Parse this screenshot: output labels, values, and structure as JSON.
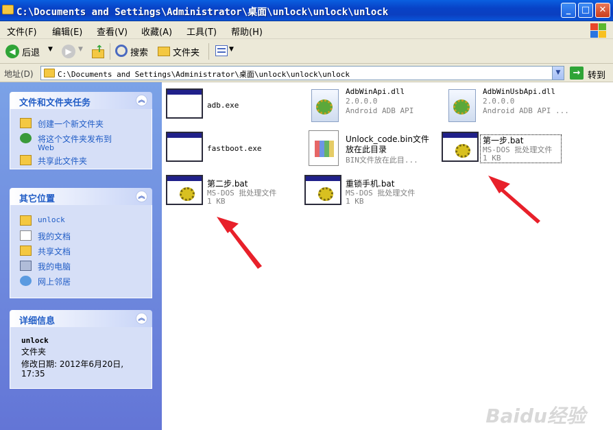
{
  "window": {
    "title": "C:\\Documents and Settings\\Administrator\\桌面\\unlock\\unlock\\unlock",
    "min": "_",
    "max": "□",
    "close": "✕"
  },
  "menu": [
    "文件(F)",
    "编辑(E)",
    "查看(V)",
    "收藏(A)",
    "工具(T)",
    "帮助(H)"
  ],
  "toolbar": {
    "back": "后退",
    "search": "搜索",
    "folders": "文件夹"
  },
  "address": {
    "label": "地址(D)",
    "path": "C:\\Documents and Settings\\Administrator\\桌面\\unlock\\unlock\\unlock",
    "go": "转到"
  },
  "tasks": {
    "title": "文件和文件夹任务",
    "items": [
      "创建一个新文件夹",
      "将这个文件夹发布到",
      "Web",
      "共享此文件夹"
    ]
  },
  "places": {
    "title": "其它位置",
    "items": [
      "unlock",
      "我的文档",
      "共享文档",
      "我的电脑",
      "网上邻居"
    ]
  },
  "details": {
    "title": "详细信息",
    "name": "unlock",
    "type": "文件夹",
    "modified": "修改日期: 2012年6月20日,",
    "time": "17:35"
  },
  "files": [
    {
      "name": "adb.exe",
      "line2": "",
      "line3": ""
    },
    {
      "name": "AdbWinApi.dll",
      "line2": "2.0.0.0",
      "line3": "Android ADB API"
    },
    {
      "name": "AdbWinUsbApi.dll",
      "line2": "2.0.0.0",
      "line3": "Android ADB API ..."
    },
    {
      "name": "fastboot.exe",
      "line2": "",
      "line3": ""
    },
    {
      "name": "Unlock_code.bin文件",
      "line2": "放在此目录",
      "line3": "BIN文件放在此目..."
    },
    {
      "name": "第一步.bat",
      "line2": "MS-DOS 批处理文件",
      "line3": "1 KB"
    },
    {
      "name": "第二步.bat",
      "line2": "MS-DOS 批处理文件",
      "line3": "1 KB"
    },
    {
      "name": "重锁手机.bat",
      "line2": "MS-DOS 批处理文件",
      "line3": "1 KB"
    }
  ],
  "watermark": "Baidu经验"
}
